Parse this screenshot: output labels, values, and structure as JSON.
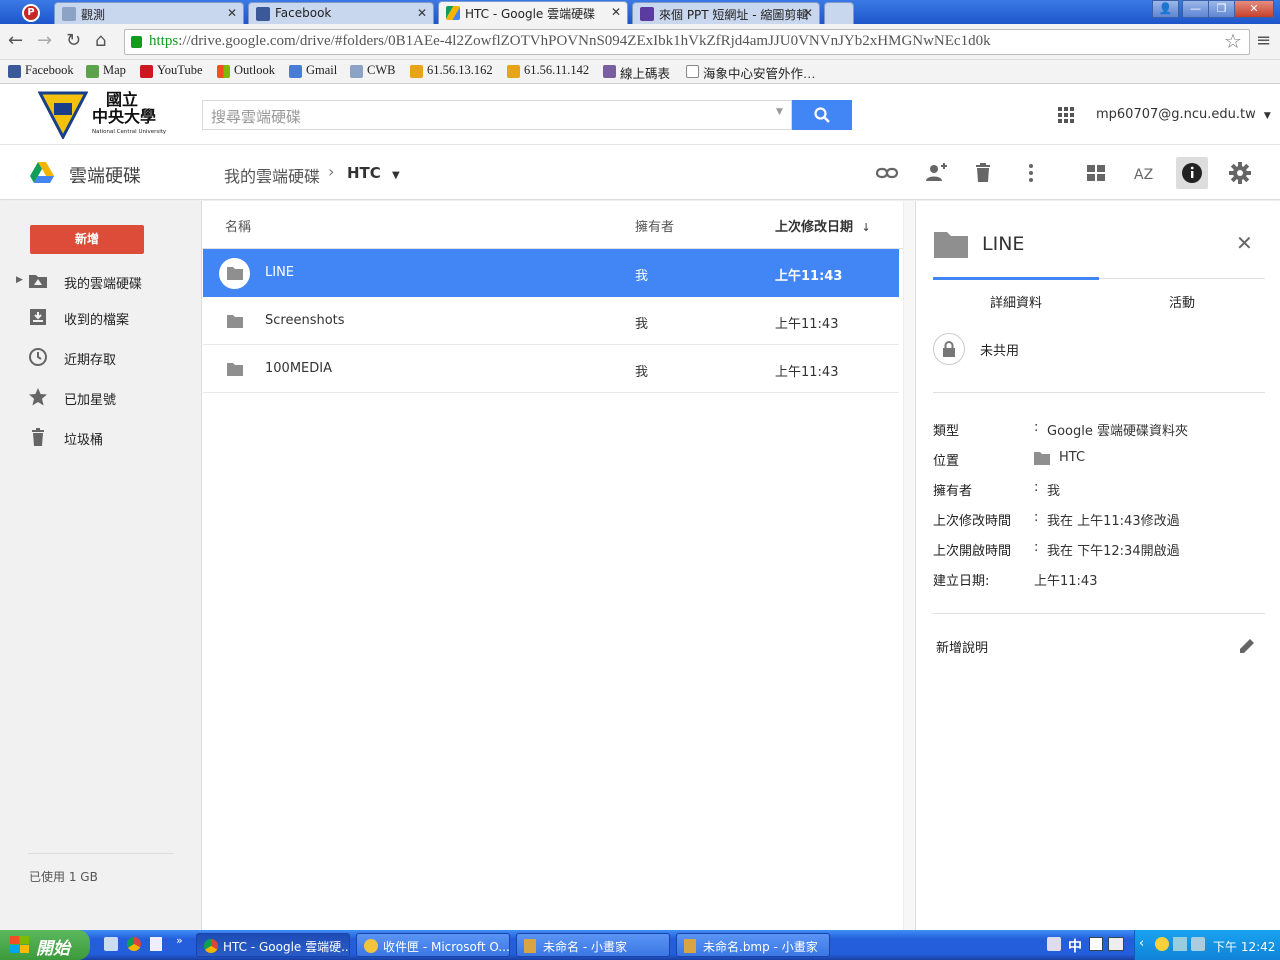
{
  "browser": {
    "tabs": [
      {
        "label": "觀測",
        "active": false
      },
      {
        "label": "Facebook",
        "active": false
      },
      {
        "label": "HTC - Google 雲端硬碟",
        "active": true
      },
      {
        "label": "來個 PPT 短網址 - 縮圖剪輯",
        "active": false
      }
    ],
    "url_scheme": "https",
    "url_rest": "://drive.google.com/drive/#folders/0B1AEe-4l2ZowflZOTVhPOVNnS094ZExIbk1hVkZfRjd4amJJU0VNVnJYb2xHMGNwNEc1d0k",
    "bookmarks": [
      "Facebook",
      "Map",
      "YouTube",
      "Outlook",
      "Gmail",
      "CWB",
      "61.56.13.162",
      "61.56.11.142",
      "線上碼表",
      "海象中心安管外作…"
    ]
  },
  "header": {
    "logo_text_line1": "國立",
    "logo_text_line2": "中央大學",
    "logo_text_en": "National Central University",
    "search_placeholder": "搜尋雲端硬碟",
    "account": "mp60707@g.ncu.edu.tw"
  },
  "toolbar": {
    "app_name": "雲端硬碟",
    "breadcrumb_root": "我的雲端硬碟",
    "breadcrumb_current": "HTC"
  },
  "sidebar": {
    "new_button": "新增",
    "items": [
      "我的雲端硬碟",
      "收到的檔案",
      "近期存取",
      "已加星號",
      "垃圾桶"
    ],
    "storage": "已使用 1 GB"
  },
  "list": {
    "columns": {
      "name": "名稱",
      "owner": "擁有者",
      "modified": "上次修改日期"
    },
    "sort_arrow": "↓",
    "rows": [
      {
        "name": "LINE",
        "owner": "我",
        "modified": "上午11:43",
        "selected": true
      },
      {
        "name": "Screenshots",
        "owner": "我",
        "modified": "上午11:43",
        "selected": false
      },
      {
        "name": "100MEDIA",
        "owner": "我",
        "modified": "上午11:43",
        "selected": false
      }
    ]
  },
  "detail": {
    "title": "LINE",
    "tab_details": "詳細資料",
    "tab_activity": "活動",
    "sharing": "未共用",
    "props": [
      {
        "label": "類型",
        "value": "Google 雲端硬碟資料夾"
      },
      {
        "label": "位置",
        "value": "HTC"
      },
      {
        "label": "擁有者",
        "value": "我"
      },
      {
        "label": "上次修改時間",
        "value": "我在 上午11:43修改過"
      },
      {
        "label": "上次開啟時間",
        "value": "我在 下午12:34開啟過"
      },
      {
        "label": "建立日期:",
        "value": "上午11:43"
      }
    ],
    "add_description": "新增說明"
  },
  "taskbar": {
    "start": "開始",
    "tasks": [
      "HTC - Google 雲端硬...",
      "收件匣 - Microsoft O...",
      "未命名 - 小畫家",
      "未命名.bmp - 小畫家"
    ],
    "ime": "中",
    "clock": "下午 12:42"
  },
  "colors": {
    "accent": "#4285f4",
    "new_button": "#dd4b39"
  }
}
